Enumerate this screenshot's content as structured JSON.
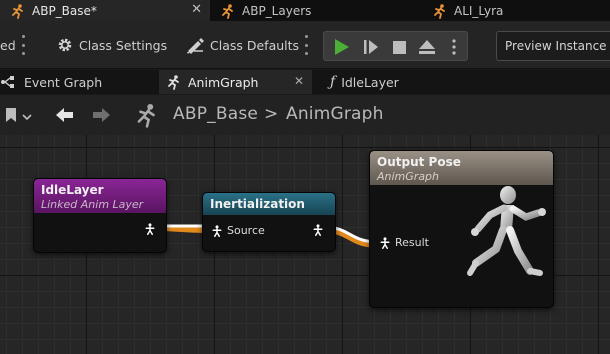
{
  "doc_tabs": [
    {
      "label": "ABP_Base*",
      "icon": "anim-blueprint-icon",
      "active": true
    },
    {
      "label": "ABP_Layers",
      "icon": "anim-blueprint-icon",
      "active": false
    },
    {
      "label": "ALI_Lyra",
      "icon": "anim-layer-interface-icon",
      "active": false
    }
  ],
  "toolbar": {
    "left_clip": "ed",
    "class_settings": "Class Settings",
    "class_defaults": "Class Defaults",
    "preview_instance": "Preview Instance"
  },
  "graph_tabs": [
    {
      "label": "Event Graph",
      "icon": "event-graph-icon"
    },
    {
      "label": "AnimGraph",
      "icon": "anim-graph-icon",
      "active": true
    },
    {
      "label": "IdleLayer",
      "icon": "function-icon"
    }
  ],
  "breadcrumb": {
    "root": "ABP_Base",
    "separator": ">",
    "current": "AnimGraph"
  },
  "nodes": {
    "idle_layer": {
      "title": "IdleLayer",
      "subtitle": "Linked Anim Layer"
    },
    "inertialization": {
      "title": "Inertialization",
      "pin_in": "Source"
    },
    "output_pose": {
      "title": "Output Pose",
      "subtitle": "AnimGraph",
      "pin_in": "Result"
    }
  },
  "colors": {
    "accent_green": "#4caf35",
    "linked_layer_header": "#7a1f86",
    "inertialization_header": "#1e5f73",
    "output_pose_header": "#8d8478",
    "wire_white": "#ffffff",
    "wire_orange": "#e18a1c"
  }
}
